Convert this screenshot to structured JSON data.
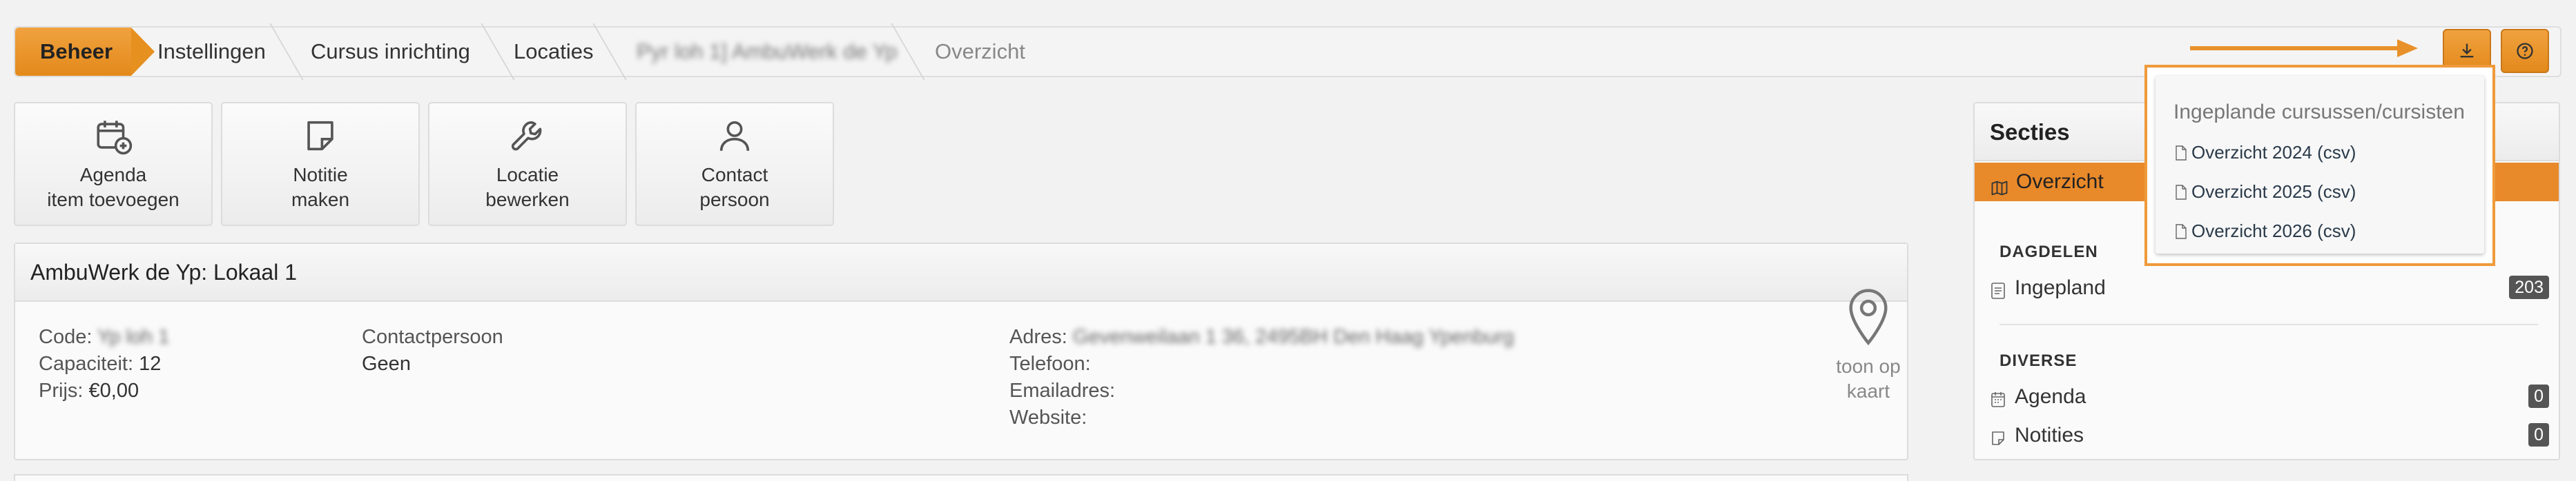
{
  "breadcrumb": {
    "items": [
      "Beheer",
      "Instellingen",
      "Cursus inrichting",
      "Locaties",
      "Pyr loh 1] AmbuWerk de Yp",
      "Overzicht"
    ]
  },
  "toolbar": {
    "download_icon": "download-icon",
    "help_icon": "help-icon"
  },
  "tiles": [
    {
      "line1": "Agenda",
      "line2": "item toevoegen",
      "icon": "calendar-plus-icon"
    },
    {
      "line1": "Notitie",
      "line2": "maken",
      "icon": "note-icon"
    },
    {
      "line1": "Locatie",
      "line2": "bewerken",
      "icon": "wrench-icon"
    },
    {
      "line1": "Contact",
      "line2": "persoon",
      "icon": "person-icon"
    }
  ],
  "location": {
    "title": "AmbuWerk de Yp: Lokaal 1",
    "code_label": "Code:",
    "code_value": "Yp loh 1",
    "capacity_label": "Capaciteit:",
    "capacity_value": "12",
    "price_label": "Prijs:",
    "price_value": "€0,00",
    "contact_label": "Contactpersoon",
    "contact_value": "Geen",
    "address_label": "Adres:",
    "address_value": "Gevenweilaan 1 36, 2495BH Den Haag Ypenburg",
    "phone_label": "Telefoon:",
    "email_label": "Emailadres:",
    "website_label": "Website:",
    "map_line1": "toon op",
    "map_line2": "kaart"
  },
  "sidebar": {
    "title": "Secties",
    "active": "Overzicht",
    "group1": "DAGDELEN",
    "ingepland_label": "Ingepland",
    "ingepland_count": "203",
    "group2": "DIVERSE",
    "agenda_label": "Agenda",
    "agenda_count": "0",
    "notities_label": "Notities",
    "notities_count": "0"
  },
  "dropdown": {
    "heading": "Ingeplande cursussen/cursisten",
    "items": [
      "Overzicht 2024 (csv)",
      "Overzicht 2025 (csv)",
      "Overzicht 2026 (csv)"
    ]
  },
  "colors": {
    "accent": "#e8892a",
    "arrow": "#e8912a"
  }
}
